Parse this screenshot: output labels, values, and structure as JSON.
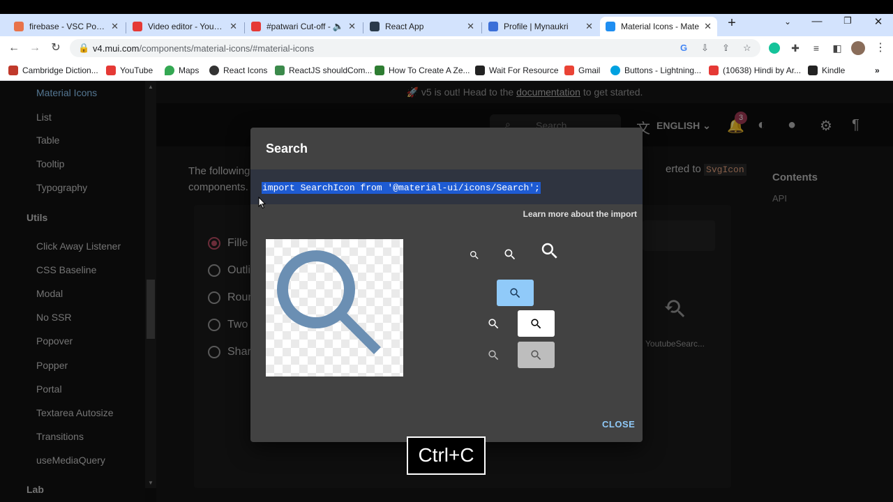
{
  "browser": {
    "tabs": [
      {
        "title": "firebase - VSC PowerS",
        "fav_color": "#e8734a"
      },
      {
        "title": "Video editor - YouTub",
        "fav_color": "#e53935"
      },
      {
        "title": "#patwari Cut-off -",
        "fav_color": "#e53935"
      },
      {
        "title": "React App",
        "fav_color": "#2a3a4a"
      },
      {
        "title": "Profile | Mynaukri",
        "fav_color": "#3b6fd8"
      },
      {
        "title": "Material Icons - Mate",
        "fav_color": "#1f8ef1"
      }
    ],
    "new_tab": "+",
    "url_domain": "v4.mui.com",
    "url_path": "/components/material-icons/#material-icons",
    "bookmarks": [
      {
        "label": "Cambridge Diction...",
        "color": "#c0392b"
      },
      {
        "label": "YouTube",
        "color": "#e53935"
      },
      {
        "label": "Maps",
        "color": "#34a853"
      },
      {
        "label": "React Icons",
        "color": "#333333"
      },
      {
        "label": "ReactJS shouldCom...",
        "color": "#3b8a4b"
      },
      {
        "label": "How To Create A Ze...",
        "color": "#2e7d32"
      },
      {
        "label": "Wait For Resource",
        "color": "#222222"
      },
      {
        "label": "Gmail",
        "color": "#ea4335"
      },
      {
        "label": "Buttons - Lightning...",
        "color": "#00a1e0"
      },
      {
        "label": "(10638) Hindi by Ar...",
        "color": "#e53935"
      },
      {
        "label": "Kindle",
        "color": "#222222"
      }
    ],
    "more_bookmarks": "»"
  },
  "sidebar": {
    "items_top": [
      "Material Icons",
      "List",
      "Table",
      "Tooltip",
      "Typography"
    ],
    "section_utils": "Utils",
    "items_utils": [
      "Click Away Listener",
      "CSS Baseline",
      "Modal",
      "No SSR",
      "Popover",
      "Popper",
      "Portal",
      "Textarea Autosize",
      "Transitions",
      "useMediaQuery"
    ],
    "section_lab": "Lab"
  },
  "header": {
    "banner_prefix": "v5 is out! Head to the",
    "banner_link": "documentation",
    "banner_suffix": "to get started.",
    "search_placeholder": "Search",
    "language": "ENGLISH",
    "notifications_count": "3"
  },
  "main": {
    "intro_line1": "The following",
    "intro_line2": "components.",
    "intro_right": "erted to",
    "svgicon_code": "SvgIcon",
    "contents_title": "Contents",
    "contents_api": "API",
    "radios": [
      "Fille",
      "Outli",
      "Roun",
      "Two",
      "Shar"
    ],
    "bg_icon_label": "YoutubeSearc..."
  },
  "dialog": {
    "title": "Search",
    "import_code": "import SearchIcon from '@material-ui/icons/Search';",
    "learn_more": "Learn more about the import",
    "close_label": "CLOSE",
    "icon_color": "#6b8fb3"
  },
  "overlay": {
    "keystroke": "Ctrl+C"
  }
}
